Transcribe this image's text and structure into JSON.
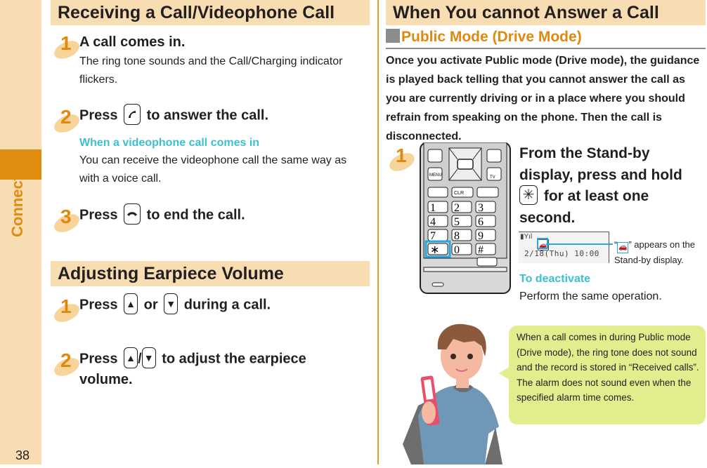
{
  "page": {
    "number": "38",
    "chapter_tab": "Connect"
  },
  "left": {
    "receiving": {
      "heading": "Receiving a Call/Videophone Call",
      "steps": [
        {
          "num": "1",
          "title": "A call comes in.",
          "body": "The ring tone sounds and the Call/Charging indicator flickers."
        },
        {
          "num": "2",
          "title_before": "Press",
          "key": "call-key",
          "title_after": "to answer the call.",
          "note_head": "When a videophone call comes in",
          "note_body": "You can receive the videophone call the same way as with a voice call."
        },
        {
          "num": "3",
          "title_before": "Press",
          "key": "end-key",
          "title_after": "to end the call."
        }
      ]
    },
    "volume": {
      "heading": "Adjusting Earpiece Volume",
      "steps": [
        {
          "num": "1",
          "title_before": "Press",
          "key1": "up-key",
          "mid": "or",
          "key2": "down-key",
          "title_after": "during a call."
        },
        {
          "num": "2",
          "title_before": "Press",
          "key1": "up-key",
          "sep": "/",
          "key2": "down-key",
          "title_after": "to adjust the earpiece",
          "title_line2": "volume."
        }
      ]
    }
  },
  "right": {
    "heading": "When You cannot Answer a Call",
    "subheading": "Public Mode (Drive Mode)",
    "intro": "Once you activate Public mode (Drive mode), the guidance is played back telling that you cannot answer the call as you are currently driving or in a place where you should refrain from speaking on the phone. Then the call is disconnected.",
    "step": {
      "num": "1",
      "line1": "From the Stand-by",
      "line2": "display, press and hold",
      "key": "asterisk-key",
      "line3_after": "for at least one",
      "line4": "second."
    },
    "screen": {
      "date": "2/18(Thu) 10:00",
      "icon": "drive-mode-icon"
    },
    "callout": {
      "quote_open": "“",
      "quote_close": "” appears on the",
      "line2": "Stand-by display."
    },
    "deactivate": {
      "head": "To deactivate",
      "body": "Perform the same operation."
    },
    "tip": "When a call comes in during Public mode (Drive mode), the ring tone does not sound and the record is stored in “Received calls”. The alarm does not sound even when the specified alarm time comes."
  },
  "colors": {
    "accent_orange": "#e0880f",
    "tab_beige": "#f7ddb1",
    "cyan": "#3cbfd0",
    "highlight_blue": "#29a8df",
    "bubble_green": "#e2ee8e"
  }
}
